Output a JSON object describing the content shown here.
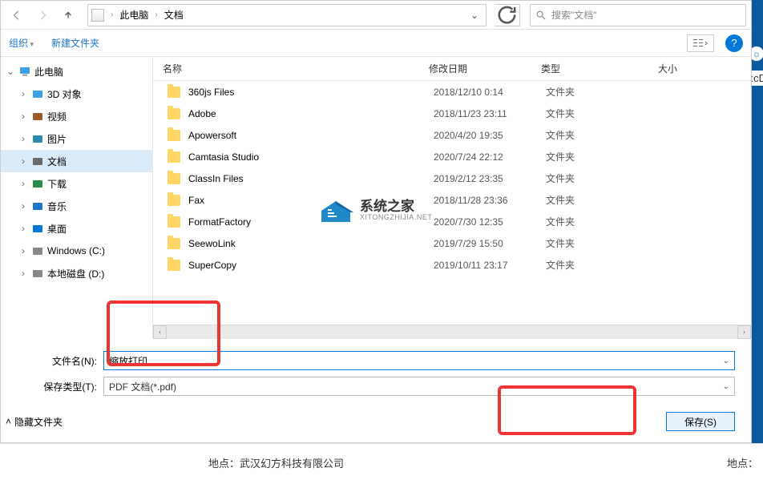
{
  "nav": {
    "crumb1": "此电脑",
    "crumb2": "文档",
    "search_placeholder": "搜索\"文档\""
  },
  "toolbar": {
    "organize": "组织",
    "newfolder": "新建文件夹"
  },
  "sidebar": {
    "root": "此电脑",
    "items": [
      {
        "label": "3D 对象",
        "color": "#3aa0e8"
      },
      {
        "label": "视频",
        "color": "#9a5a2a"
      },
      {
        "label": "图片",
        "color": "#2a8aa8"
      },
      {
        "label": "文档",
        "color": "#6a6a6a",
        "selected": true
      },
      {
        "label": "下载",
        "color": "#2a8a4a"
      },
      {
        "label": "音乐",
        "color": "#1e74c8"
      },
      {
        "label": "桌面",
        "color": "#0078d7"
      },
      {
        "label": "Windows (C:)",
        "color": "#888"
      },
      {
        "label": "本地磁盘 (D:)",
        "color": "#888"
      }
    ]
  },
  "columns": {
    "name": "名称",
    "date": "修改日期",
    "type": "类型",
    "size": "大小"
  },
  "files": [
    {
      "name": "360js Files",
      "date": "2018/12/10 0:14",
      "type": "文件夹"
    },
    {
      "name": "Adobe",
      "date": "2018/11/23 23:11",
      "type": "文件夹"
    },
    {
      "name": "Apowersoft",
      "date": "2020/4/20 19:35",
      "type": "文件夹"
    },
    {
      "name": "Camtasia Studio",
      "date": "2020/7/24 22:12",
      "type": "文件夹"
    },
    {
      "name": "ClassIn Files",
      "date": "2019/2/12 23:35",
      "type": "文件夹"
    },
    {
      "name": "Fax",
      "date": "2018/11/28 23:36",
      "type": "文件夹"
    },
    {
      "name": "FormatFactory",
      "date": "2020/7/30 12:35",
      "type": "文件夹"
    },
    {
      "name": "SeewoLink",
      "date": "2019/7/29 15:50",
      "type": "文件夹"
    },
    {
      "name": "SuperCopy",
      "date": "2019/10/11 23:17",
      "type": "文件夹"
    }
  ],
  "watermark": {
    "big": "系统之家",
    "small": "XITONGZHIJIA.NET"
  },
  "fields": {
    "filename_label": "文件名(N):",
    "filename_value": "缩放打印",
    "filetype_label": "保存类型(T):",
    "filetype_value": "PDF 文档(*.pdf)"
  },
  "footer": {
    "hide": "隐藏文件夹",
    "save": "保存(S)"
  },
  "bg": {
    "left": "地点：武汉幻方科技有限公司",
    "right": "地点：",
    "edge": ":cD"
  }
}
